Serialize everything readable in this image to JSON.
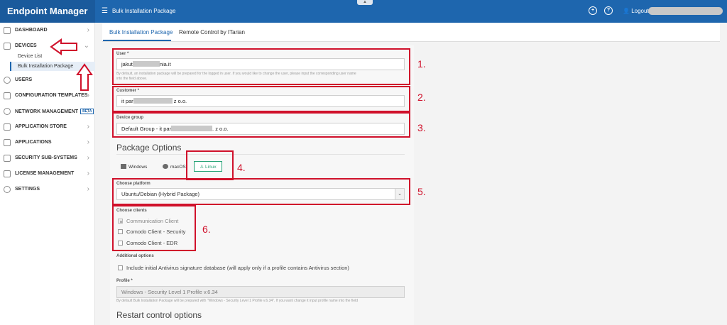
{
  "app": {
    "brand": "Endpoint Manager",
    "page_title": "Bulk Installation Package",
    "logout_label": "Logout"
  },
  "sidebar": {
    "items": [
      {
        "label": "DASHBOARD"
      },
      {
        "label": "DEVICES"
      },
      {
        "label": "USERS"
      },
      {
        "label": "CONFIGURATION TEMPLATES"
      },
      {
        "label": "NETWORK MANAGEMENT",
        "badge": "BETA"
      },
      {
        "label": "APPLICATION STORE"
      },
      {
        "label": "APPLICATIONS"
      },
      {
        "label": "SECURITY SUB-SYSTEMS"
      },
      {
        "label": "LICENSE MANAGEMENT"
      },
      {
        "label": "SETTINGS"
      }
    ],
    "devices_sub": [
      {
        "label": "Device List"
      },
      {
        "label": "Bulk Installation Package",
        "active": true
      }
    ]
  },
  "tabs": [
    {
      "label": "Bulk Installation Package",
      "active": true
    },
    {
      "label": "Remote Control by ITarian"
    }
  ],
  "form": {
    "user": {
      "label": "User *",
      "value_start": "jakut",
      "value_end": "nia.it",
      "hint_line1": "By default, an installation package will be prepared for the logged in user. If you would like to change the user, please input the corresponding user name",
      "hint_line2": "into the field above."
    },
    "customer": {
      "label": "Customer *",
      "value_start": "it par",
      "value_end": "z o.o."
    },
    "device_group": {
      "label": "Device group",
      "value_start": "Default Group - it par",
      "value_end": ". z o.o."
    },
    "package_options": "Package Options",
    "os": [
      {
        "label": "Windows"
      },
      {
        "label": "macOS"
      },
      {
        "label": "Linux",
        "selected": true
      }
    ],
    "platform": {
      "label": "Choose platform",
      "value": "Ubuntu/Debian (Hybrid Package)"
    },
    "clients": {
      "label": "Choose clients",
      "items": [
        {
          "label": "Communication Client",
          "checked": true,
          "disabled": true
        },
        {
          "label": "Comodo Client - Security",
          "checked": false
        },
        {
          "label": "Comodo Client - EDR",
          "checked": false
        }
      ]
    },
    "additional": {
      "label": "Additional options",
      "item": "Include initial Antivirus signature database (will apply only if a profile contains Antivirus section)"
    },
    "profile": {
      "label": "Profile *",
      "value": "Windows - Security Level 1 Profile v.6.34",
      "hint": "By default Bulk Installation Package will be prepared with \"Windows - Security Level 1 Profile v.6.34\". If you want change it input profile name into the field"
    },
    "restart_title": "Restart control options"
  },
  "annotations": [
    "1.",
    "2.",
    "3.",
    "4.",
    "5.",
    "6."
  ],
  "colors": {
    "topbar": "#1e66ae",
    "accent_green": "#27a376",
    "annotation_red": "#d0112b"
  }
}
